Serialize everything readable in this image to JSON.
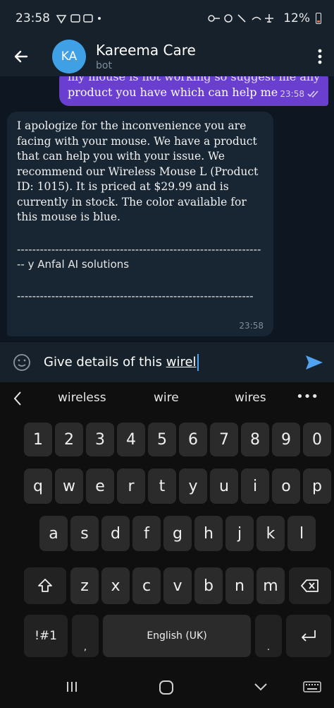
{
  "status_bar": {
    "time": "23:58",
    "battery": "12%"
  },
  "header": {
    "avatar_initials": "KA",
    "title": "Kareema Care",
    "subtitle": "bot"
  },
  "messages": {
    "outgoing": {
      "line1": "my mouse is not working so suggest me any",
      "line2": "product you have which can help me",
      "time": "23:58"
    },
    "incoming": {
      "body": "I apologize for the inconvenience you are facing with your mouse. We have a product that can help you with your issue. We recommend our Wireless Mouse L (Product ID: 1015). It is priced at $29.99 and is currently in stock. The color available for this mouse is blue.",
      "signature": "------------------------------------------------------------------ y Anfal AI solutions",
      "separator": "--------------------------------------------------------------",
      "time": "23:58"
    }
  },
  "composer": {
    "text_plain": "Give details of this ",
    "text_underlined": "wirel"
  },
  "keyboard": {
    "suggestions": [
      "wireless",
      "wire",
      "wires"
    ],
    "more": "•••",
    "row_numbers": [
      "1",
      "2",
      "3",
      "4",
      "5",
      "6",
      "7",
      "8",
      "9",
      "0"
    ],
    "row_top": [
      "q",
      "w",
      "e",
      "r",
      "t",
      "y",
      "u",
      "i",
      "o",
      "p"
    ],
    "row_mid": [
      "a",
      "s",
      "d",
      "f",
      "g",
      "h",
      "j",
      "k",
      "l"
    ],
    "row_bottom": [
      "z",
      "x",
      "c",
      "v",
      "b",
      "n",
      "m"
    ],
    "symbols_label": "!#1",
    "comma_label": ",",
    "space_label": "English (UK)",
    "period_label": "."
  },
  "colors": {
    "outgoing_bubble": "#6a3fd0",
    "incoming_bubble": "#182533",
    "header_bg": "#17212b",
    "accent": "#4fa3f0"
  }
}
